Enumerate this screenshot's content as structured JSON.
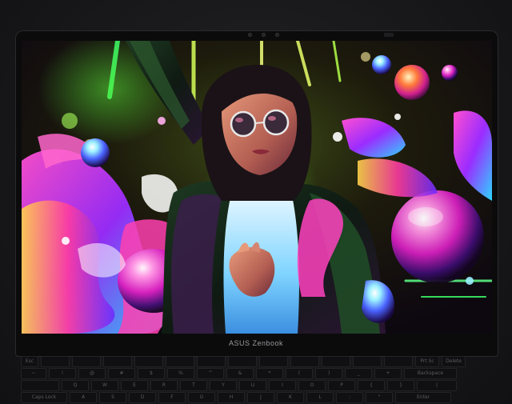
{
  "laptop": {
    "brand_label": "ASUS Zenbook"
  },
  "keyboard": {
    "row1": [
      "Esc",
      "",
      "",
      "",
      "",
      "",
      "",
      "",
      "",
      "",
      "",
      "",
      "",
      "Prt Sc",
      "Delete"
    ],
    "row2": [
      "~",
      "!",
      "@",
      "#",
      "$",
      "%",
      "^",
      "&",
      "*",
      "(",
      ")",
      "_",
      "+",
      "Backspace"
    ],
    "row3": [
      "",
      "Q",
      "W",
      "E",
      "R",
      "T",
      "Y",
      "U",
      "I",
      "O",
      "P",
      "{",
      "}",
      "|"
    ],
    "row4": [
      "Caps Lock",
      "A",
      "S",
      "D",
      "F",
      "G",
      "H",
      "J",
      "K",
      "L",
      ":",
      "\"",
      "Enter"
    ]
  },
  "colors": {
    "neon_pink": "#ff2fb6",
    "neon_green": "#4dff3a",
    "neon_cyan": "#37d7ff",
    "neon_violet": "#7a3cff"
  }
}
